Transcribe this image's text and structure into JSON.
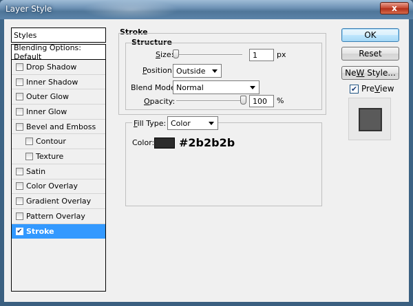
{
  "window": {
    "title": "Layer Style",
    "close_label": "x"
  },
  "sidebar": {
    "header": "Styles",
    "items": [
      {
        "label": "Blending Options: Default",
        "checkbox": false,
        "checked": false,
        "sub": false
      },
      {
        "label": "Drop Shadow",
        "checkbox": true,
        "checked": false,
        "sub": false
      },
      {
        "label": "Inner Shadow",
        "checkbox": true,
        "checked": false,
        "sub": false
      },
      {
        "label": "Outer Glow",
        "checkbox": true,
        "checked": false,
        "sub": false
      },
      {
        "label": "Inner Glow",
        "checkbox": true,
        "checked": false,
        "sub": false
      },
      {
        "label": "Bevel and Emboss",
        "checkbox": true,
        "checked": false,
        "sub": false
      },
      {
        "label": "Contour",
        "checkbox": true,
        "checked": false,
        "sub": true
      },
      {
        "label": "Texture",
        "checkbox": true,
        "checked": false,
        "sub": true
      },
      {
        "label": "Satin",
        "checkbox": true,
        "checked": false,
        "sub": false
      },
      {
        "label": "Color Overlay",
        "checkbox": true,
        "checked": false,
        "sub": false
      },
      {
        "label": "Gradient Overlay",
        "checkbox": true,
        "checked": false,
        "sub": false
      },
      {
        "label": "Pattern Overlay",
        "checkbox": true,
        "checked": false,
        "sub": false
      },
      {
        "label": "Stroke",
        "checkbox": true,
        "checked": true,
        "sub": false,
        "selected": true
      }
    ]
  },
  "stroke": {
    "title": "Stroke",
    "structure_title": "Structure",
    "size_label_key": "S",
    "size_label_rest": "ize:",
    "size_value": "1",
    "size_unit": "px",
    "size_level": 0.01,
    "position_label_key": "P",
    "position_label_rest": "osition:",
    "position_value": "Outside",
    "blend_label_pre": "Blend Mode:",
    "blend_value": "Normal",
    "opacity_label_key": "O",
    "opacity_label_rest": "pacity:",
    "opacity_value": "100",
    "opacity_unit": "%",
    "opacity_level": 1.0,
    "fill_type_label_key": "F",
    "fill_type_label_rest": "ill Type:",
    "fill_type_value": "Color",
    "color_label": "Color:",
    "color_hex": "#2b2b2b",
    "color_swatch": "#2b2b2b"
  },
  "buttons": {
    "ok": "OK",
    "reset": "Reset",
    "new_style_key": "W",
    "new_style_pre": "Ne",
    "new_style_post": " Style...",
    "preview_key": "V",
    "preview_pre": "Pre",
    "preview_post": "iew",
    "preview_checked": true
  },
  "icons": {
    "checkmark": "checkmark-icon",
    "dropdown": "chevron-down-icon",
    "close": "close-icon"
  }
}
